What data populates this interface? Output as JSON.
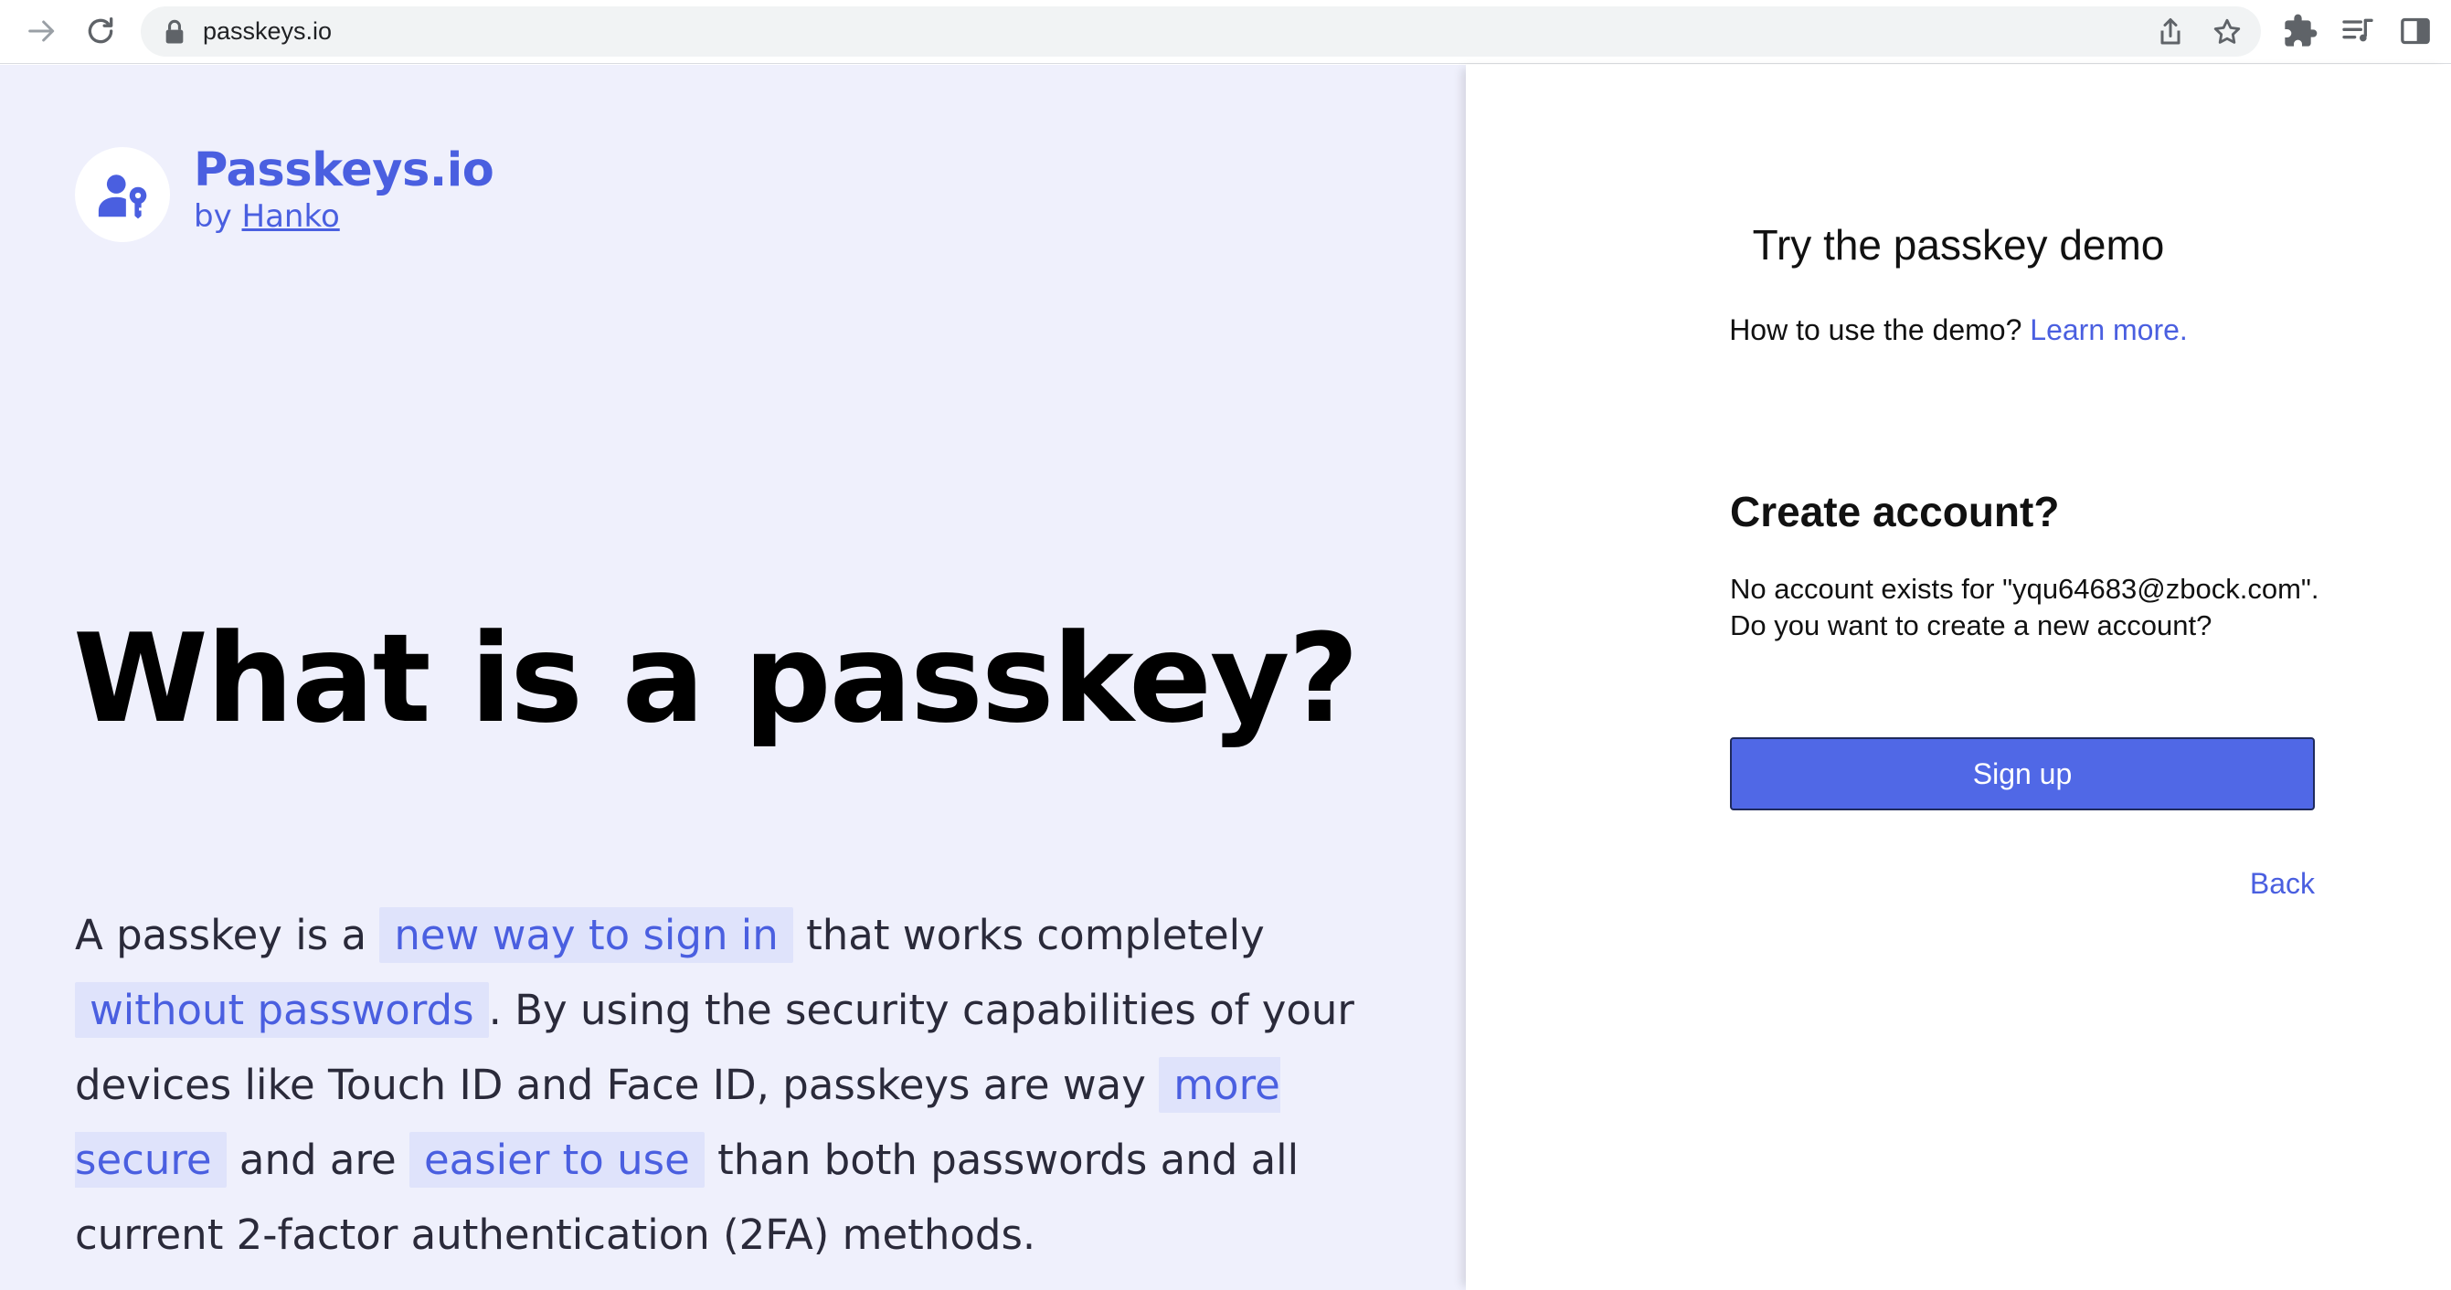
{
  "browser": {
    "url": "passkeys.io"
  },
  "brand": {
    "title": "Passkeys.io",
    "by_prefix": "by",
    "by_link": "Hanko",
    "accent_color": "#4a5fe0"
  },
  "hero": {
    "title": "What is a passkey?",
    "body": [
      {
        "text": "A passkey is a ",
        "highlight": false
      },
      {
        "text": "new way to sign in",
        "highlight": true
      },
      {
        "text": " that works completely ",
        "highlight": false
      },
      {
        "text": "without passwords",
        "highlight": true
      },
      {
        "text": ". By using the security capabilities of your devices like Touch ID and Face ID, passkeys are way ",
        "highlight": false
      },
      {
        "text": "more secure",
        "highlight": true
      },
      {
        "text": " and are ",
        "highlight": false
      },
      {
        "text": "easier to use",
        "highlight": true
      },
      {
        "text": " than both passwords and all current 2-factor authentication (2FA) methods.",
        "highlight": false
      }
    ]
  },
  "demo": {
    "title": "Try the passkey demo",
    "help_text": "How to use the demo?",
    "help_link": "Learn more.",
    "create_title": "Create account?",
    "create_message": "No account exists for \"yqu64683@zbock.com\". Do you want to create a new account?",
    "signup_label": "Sign up",
    "back_label": "Back",
    "button_color": "#5068e6"
  },
  "icons": {
    "forward": "arrow-right-icon",
    "reload": "reload-icon",
    "lock": "lock-icon",
    "share": "share-icon",
    "bookmark": "star-icon",
    "extensions": "puzzle-icon",
    "reading_list": "reading-list-icon",
    "side_panel": "side-panel-icon",
    "logo": "user-key-icon"
  }
}
